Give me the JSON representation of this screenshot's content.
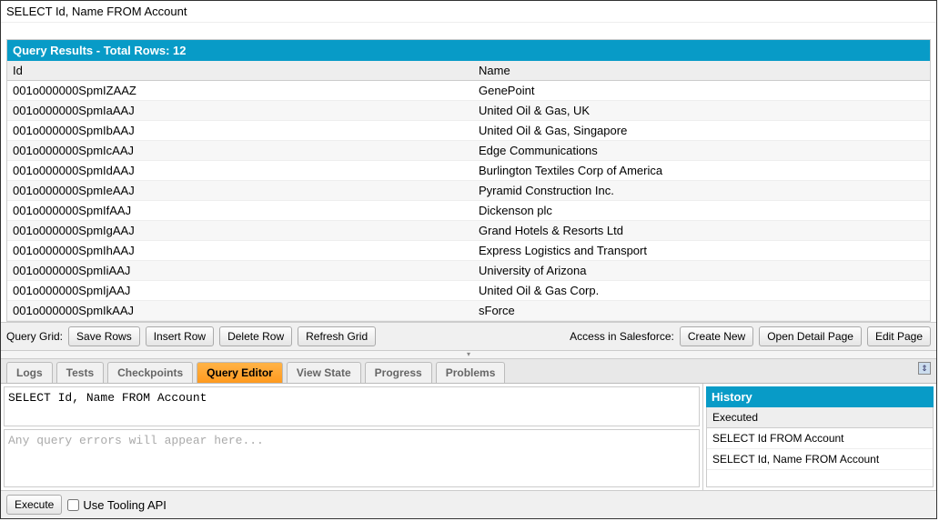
{
  "query_top": "SELECT Id, Name FROM Account",
  "results": {
    "header": "Query Results - Total Rows: 12",
    "columns": {
      "id": "Id",
      "name": "Name"
    },
    "rows": [
      {
        "id": "001o000000SpmIZAAZ",
        "name": "GenePoint"
      },
      {
        "id": "001o000000SpmIaAAJ",
        "name": "United Oil & Gas, UK"
      },
      {
        "id": "001o000000SpmIbAAJ",
        "name": "United Oil & Gas, Singapore"
      },
      {
        "id": "001o000000SpmIcAAJ",
        "name": "Edge Communications"
      },
      {
        "id": "001o000000SpmIdAAJ",
        "name": "Burlington Textiles Corp of America"
      },
      {
        "id": "001o000000SpmIeAAJ",
        "name": "Pyramid Construction Inc."
      },
      {
        "id": "001o000000SpmIfAAJ",
        "name": "Dickenson plc"
      },
      {
        "id": "001o000000SpmIgAAJ",
        "name": "Grand Hotels & Resorts Ltd"
      },
      {
        "id": "001o000000SpmIhAAJ",
        "name": "Express Logistics and Transport"
      },
      {
        "id": "001o000000SpmIiAAJ",
        "name": "University of Arizona"
      },
      {
        "id": "001o000000SpmIjAAJ",
        "name": "United Oil & Gas Corp."
      },
      {
        "id": "001o000000SpmIkAAJ",
        "name": "sForce"
      }
    ]
  },
  "grid_actions": {
    "label": "Query Grid:",
    "save_rows": "Save Rows",
    "insert_row": "Insert Row",
    "delete_row": "Delete Row",
    "refresh_grid": "Refresh Grid",
    "access_label": "Access in Salesforce:",
    "create_new": "Create New",
    "open_detail": "Open Detail Page",
    "edit_page": "Edit Page"
  },
  "tabs": {
    "logs": "Logs",
    "tests": "Tests",
    "checkpoints": "Checkpoints",
    "query_editor": "Query Editor",
    "view_state": "View State",
    "progress": "Progress",
    "problems": "Problems"
  },
  "editor": {
    "query_text": "SELECT Id, Name FROM Account",
    "errors_placeholder": "Any query errors will appear here..."
  },
  "history": {
    "title": "History",
    "subtitle": "Executed",
    "items": [
      "SELECT Id FROM Account",
      "SELECT Id, Name FROM Account"
    ]
  },
  "bottom": {
    "execute": "Execute",
    "tooling_label": "Use Tooling API"
  }
}
